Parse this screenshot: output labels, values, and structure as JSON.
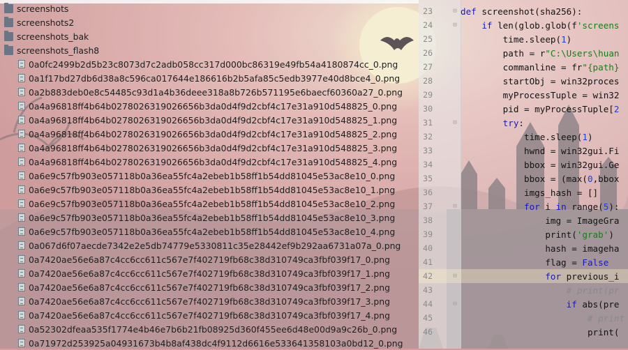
{
  "project_tree": {
    "folders": [
      {
        "label": "screenshots"
      },
      {
        "label": "screenshots2"
      },
      {
        "label": "screenshots_bak"
      },
      {
        "label": "screenshots_flash8"
      }
    ],
    "files": [
      {
        "label": "0a0fc2499b2d5b23c8073d7c2adb058cc317d000bc86319e49fb54a4180874cc_0.png"
      },
      {
        "label": "0a1f17bd27db6d38a8c596ca017644e186616b2b5afa85c5edb3977e40d8bce4_0.png"
      },
      {
        "label": "0a2b883deb0e8c54485c93d1a4b36deee318a8b726b571195e6baecf60360a27_0.png"
      },
      {
        "label": "0a4a96818ff4b64b0278026319026656b3da0d4f9d2cbf4c17e31a910d548825_0.png"
      },
      {
        "label": "0a4a96818ff4b64b0278026319026656b3da0d4f9d2cbf4c17e31a910d548825_1.png"
      },
      {
        "label": "0a4a96818ff4b64b0278026319026656b3da0d4f9d2cbf4c17e31a910d548825_2.png"
      },
      {
        "label": "0a4a96818ff4b64b0278026319026656b3da0d4f9d2cbf4c17e31a910d548825_3.png"
      },
      {
        "label": "0a4a96818ff4b64b0278026319026656b3da0d4f9d2cbf4c17e31a910d548825_4.png"
      },
      {
        "label": "0a6e9c57fb903e057118b0a36ea55fc4a2ebeb1b58ff1b54dd81045e53ac8e10_0.png"
      },
      {
        "label": "0a6e9c57fb903e057118b0a36ea55fc4a2ebeb1b58ff1b54dd81045e53ac8e10_1.png"
      },
      {
        "label": "0a6e9c57fb903e057118b0a36ea55fc4a2ebeb1b58ff1b54dd81045e53ac8e10_2.png"
      },
      {
        "label": "0a6e9c57fb903e057118b0a36ea55fc4a2ebeb1b58ff1b54dd81045e53ac8e10_3.png"
      },
      {
        "label": "0a6e9c57fb903e057118b0a36ea55fc4a2ebeb1b58ff1b54dd81045e53ac8e10_4.png"
      },
      {
        "label": "0a067d6f07aecde7342e2e5db74779e5330811c35e28442ef9b292aa6731a07a_0.png"
      },
      {
        "label": "0a7420ae56e6a87c4cc6cc611c567e7f402719fb68c38d310749ca3fbf039f17_0.png"
      },
      {
        "label": "0a7420ae56e6a87c4cc6cc611c567e7f402719fb68c38d310749ca3fbf039f17_1.png"
      },
      {
        "label": "0a7420ae56e6a87c4cc6cc611c567e7f402719fb68c38d310749ca3fbf039f17_2.png"
      },
      {
        "label": "0a7420ae56e6a87c4cc6cc611c567e7f402719fb68c38d310749ca3fbf039f17_3.png"
      },
      {
        "label": "0a7420ae56e6a87c4cc6cc611c567e7f402719fb68c38d310749ca3fbf039f17_4.png"
      },
      {
        "label": "0a52302dfeaa535f1774e4b46e7b6b21fb08925d360f455ee6d48e00d9a9c26b_0.png"
      },
      {
        "label": "0a71972d253925a04931673b4b8af438dc4f9112d6616e533641358103a0bd12_0.png"
      }
    ]
  },
  "editor": {
    "lines": [
      {
        "num": "23",
        "fold": "⊟",
        "html": "<span class=\"kw\">def</span> screenshot(sha256):"
      },
      {
        "num": "24",
        "fold": "⊟",
        "html": "    <span class=\"kw\">if</span> len(glob.glob(f<span class=\"str\">'screens</span>"
      },
      {
        "num": "25",
        "fold": "",
        "html": "        time.sleep(<span class=\"num-lit\">1</span>)"
      },
      {
        "num": "26",
        "fold": "",
        "html": "        path = r<span class=\"str\">\"C:\\Users\\huan</span>"
      },
      {
        "num": "27",
        "fold": "",
        "html": "        commanline = fr<span class=\"str\">\"{path}</span>"
      },
      {
        "num": "28",
        "fold": "",
        "html": "        startObj = win32proces"
      },
      {
        "num": "29",
        "fold": "",
        "html": "        myProcessTuple = win32"
      },
      {
        "num": "30",
        "fold": "",
        "html": "        pid = myProcessTuple[<span class=\"num-lit\">2</span>"
      },
      {
        "num": "31",
        "fold": "⊟",
        "html": "        <span class=\"kw\">try</span>:"
      },
      {
        "num": "32",
        "fold": "",
        "html": "            time.sleep(<span class=\"num-lit\">1</span>)"
      },
      {
        "num": "33",
        "fold": "",
        "html": "            hwnd = win32gui.Fi"
      },
      {
        "num": "34",
        "fold": "",
        "html": "            bbox = win32gui.Ge"
      },
      {
        "num": "35",
        "fold": "",
        "html": "            bbox = (max(<span class=\"num-lit\">0</span>,bbox"
      },
      {
        "num": "36",
        "fold": "",
        "html": "            imgs_hash = []"
      },
      {
        "num": "37",
        "fold": "⊟",
        "html": "            <span class=\"kw\">for</span> i <span class=\"kw\">in</span> range(<span class=\"num-lit\">5</span>):"
      },
      {
        "num": "38",
        "fold": "",
        "html": "                img = ImageGra"
      },
      {
        "num": "39",
        "fold": "",
        "html": "                print(<span class=\"str\">'grab'</span>)"
      },
      {
        "num": "40",
        "fold": "",
        "html": "                hash = imageha"
      },
      {
        "num": "41",
        "fold": "",
        "html": "                flag = <span class=\"kw\">False</span>"
      },
      {
        "num": "42",
        "fold": "⊟",
        "html": "                <span class=\"kw\">for</span> previous_i"
      },
      {
        "num": "43",
        "fold": "",
        "html": "                    <span class=\"cmt\"># print(pr</span>"
      },
      {
        "num": "44",
        "fold": "⊟",
        "html": "                    <span class=\"kw\">if</span> abs(pre"
      },
      {
        "num": "45",
        "fold": "",
        "html": "                        <span class=\"cmt\"># print</span>"
      },
      {
        "num": "46",
        "fold": "",
        "html": "                        print("
      }
    ]
  },
  "colors": {
    "wallpaper_pink": "#d79a9a",
    "moon": "#f6ecc4",
    "silhouette": "#5a4a50",
    "keyword_blue": "#1919b4",
    "string_green": "#1a7a1a"
  }
}
